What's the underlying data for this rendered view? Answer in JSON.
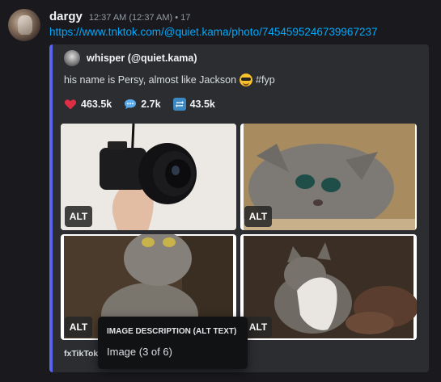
{
  "message": {
    "username": "dargy",
    "timestamp": "12:37 AM (12:37 AM) • 17",
    "link": "https://www.tnktok.com/@quiet.kama/photo/7454595246739967237"
  },
  "embed": {
    "accent_color": "#5865f2",
    "author": "whisper (@quiet.kama)",
    "description_text": "his name is Persy, almost like Jackson",
    "description_emoji": "smiling-face-with-sunglasses",
    "description_hashtag": "#fyp",
    "stats": {
      "likes": "463.5k",
      "comments": "2.7k",
      "shares": "43.5k"
    },
    "images": [
      {
        "alt_label": "ALT"
      },
      {
        "alt_label": "ALT"
      },
      {
        "alt_label": "ALT"
      },
      {
        "alt_label": "ALT"
      }
    ],
    "footer": "fxTikTok •"
  },
  "tooltip": {
    "title": "IMAGE DESCRIPTION (ALT TEXT)",
    "body": "Image (3 of 6)"
  }
}
